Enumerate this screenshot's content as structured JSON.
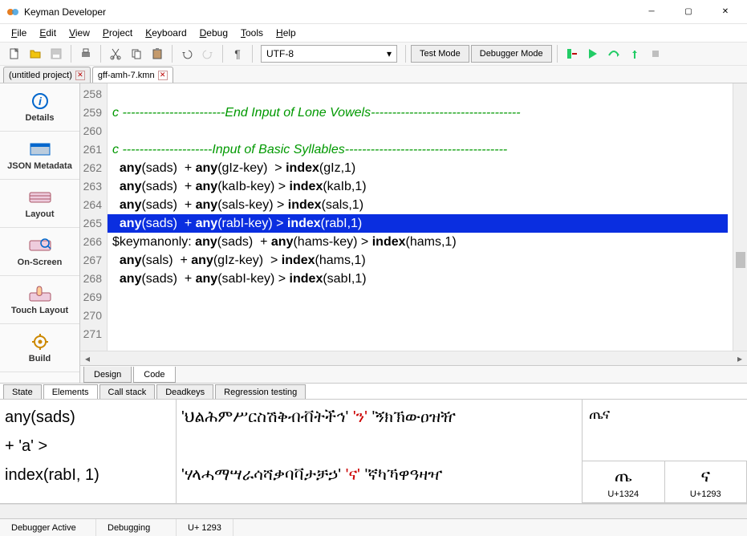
{
  "app": {
    "title": "Keyman Developer"
  },
  "menu": [
    "File",
    "Edit",
    "View",
    "Project",
    "Keyboard",
    "Debug",
    "Tools",
    "Help"
  ],
  "encoding": {
    "value": "UTF-8"
  },
  "toolbar_buttons": {
    "test": "Test Mode",
    "debugger": "Debugger Mode"
  },
  "doc_tabs": [
    {
      "label": "(untitled project)",
      "active": false
    },
    {
      "label": "gff-amh-7.kmn",
      "active": true
    }
  ],
  "sidebar": {
    "items": [
      {
        "label": "Details"
      },
      {
        "label": "JSON Metadata"
      },
      {
        "label": "Layout"
      },
      {
        "label": "On-Screen"
      },
      {
        "label": "Touch Layout"
      },
      {
        "label": "Build"
      }
    ]
  },
  "editor": {
    "first_line": 258,
    "lines": [
      {
        "n": 258,
        "type": "blank"
      },
      {
        "n": 259,
        "type": "comment",
        "text": "c ------------------------End Input of Lone Vowels-----------------------------------"
      },
      {
        "n": 260,
        "type": "blank"
      },
      {
        "n": 261,
        "type": "comment",
        "text": "c ---------------------Input of Basic Syllables--------------------------------------"
      },
      {
        "n": 262,
        "type": "rule",
        "parts": [
          "  ",
          "any",
          "(sads)  + ",
          "any",
          "(gIz-key)  > ",
          "index",
          "(gIz,1)"
        ]
      },
      {
        "n": 263,
        "type": "rule",
        "parts": [
          "  ",
          "any",
          "(sads)  + ",
          "any",
          "(kaIb-key) > ",
          "index",
          "(kaIb,1)"
        ]
      },
      {
        "n": 264,
        "type": "rule",
        "parts": [
          "  ",
          "any",
          "(sads)  + ",
          "any",
          "(sals-key) > ",
          "index",
          "(sals,1)"
        ]
      },
      {
        "n": 265,
        "type": "rule_selected",
        "parts": [
          "  ",
          "any",
          "(sads)  + ",
          "any",
          "(rabI-key) > ",
          "index",
          "(rabI,1)"
        ]
      },
      {
        "n": 266,
        "type": "rule",
        "parts": [
          "$keymanonly: ",
          "any",
          "(sads)  + ",
          "any",
          "(hams-key) > ",
          "index",
          "(hams,1)"
        ]
      },
      {
        "n": 267,
        "type": "rule",
        "parts": [
          "  ",
          "any",
          "(sals)  + ",
          "any",
          "(gIz-key)  > ",
          "index",
          "(hams,1)"
        ]
      },
      {
        "n": 268,
        "type": "rule",
        "parts": [
          "  ",
          "any",
          "(sads)  + ",
          "any",
          "(sabI-key) > ",
          "index",
          "(sabI,1)"
        ]
      },
      {
        "n": 269,
        "type": "blank"
      },
      {
        "n": 270,
        "type": "blank"
      },
      {
        "n": 271,
        "type": "blank"
      }
    ],
    "bottom_tabs": [
      {
        "label": "Design",
        "active": false
      },
      {
        "label": "Code",
        "active": true
      }
    ]
  },
  "debugger": {
    "tabs": [
      "State",
      "Elements",
      "Call stack",
      "Deadkeys",
      "Regression testing"
    ],
    "active_tab": 1,
    "col1_lines": [
      "any(sads)",
      "+ 'a' >",
      "index(rabI, 1)"
    ],
    "col2_rows": [
      {
        "set": "'ህልሕምሥርስሽቅብቭትችኅ'",
        "red": "'ን'",
        "tail": "'ኝክኽውዐዝዥ"
      },
      {
        "set": "",
        "red": "",
        "tail": ""
      },
      {
        "set": "'ሃላሓማሣራሳሻቃባቫታቻኃ'",
        "red": "'ና'",
        "tail": "'ኛካኻዋዓዛዣ"
      }
    ],
    "preview_text": "ጤና",
    "codepoints": [
      {
        "glyph": "ጤ",
        "code": "U+1324"
      },
      {
        "glyph": "ና",
        "code": "U+1293"
      }
    ]
  },
  "status": {
    "a": "Debugger Active",
    "b": "Debugging",
    "c": "U+ 1293"
  }
}
